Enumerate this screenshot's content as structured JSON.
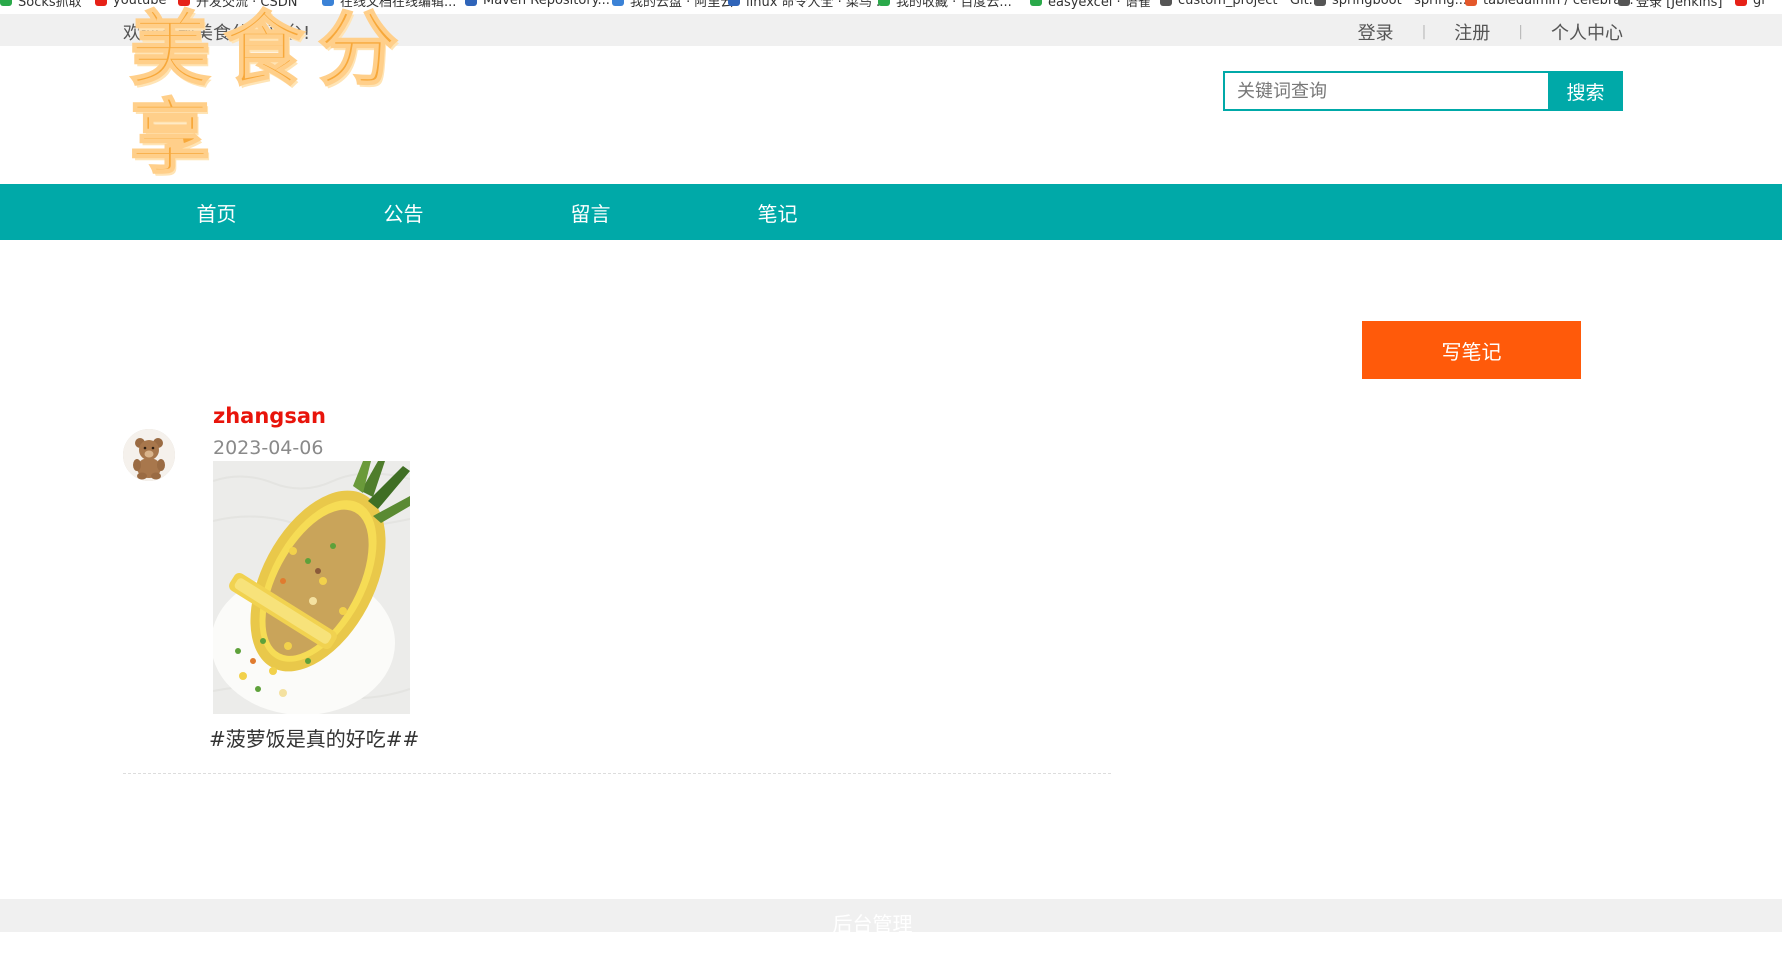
{
  "bookmarks": [
    {
      "label": "Socks抓取",
      "color": "#2aa94a"
    },
    {
      "label": "youtube",
      "color": "#e62117"
    },
    {
      "label": "开发交流 · CSDN",
      "color": "#e62117"
    },
    {
      "label": "在线文档在线编辑...",
      "color": "#3b82d6"
    },
    {
      "label": "Maven Repository...",
      "color": "#2f64b9"
    },
    {
      "label": "我的云盘 · 阿里云",
      "color": "#3b82d6"
    },
    {
      "label": "linux 命令大全 · 菜鸟 ...",
      "color": "#2f64b9"
    },
    {
      "label": "我的收藏 · 百度云...",
      "color": "#2aa94a"
    },
    {
      "label": "easyexcel · 语雀",
      "color": "#2aa94a"
    },
    {
      "label": "custom_project · Git...",
      "color": "#555555"
    },
    {
      "label": "springboot · spring...",
      "color": "#555555"
    },
    {
      "label": "tabledaimin / celebra...",
      "color": "#e4582b"
    },
    {
      "label": "登录 [Jenkins]",
      "color": "#555555"
    },
    {
      "label": "gi",
      "color": "#e62117"
    }
  ],
  "topbar": {
    "welcome": "欢迎来到美食分享平台!",
    "login": "登录",
    "register": "注册",
    "profile": "个人中心"
  },
  "header": {
    "logo_text": "美食分享",
    "search_placeholder": "关键词查询",
    "search_button": "搜索"
  },
  "nav": {
    "items": [
      "首页",
      "公告",
      "留言",
      "笔记"
    ]
  },
  "main": {
    "write_button": "写笔记",
    "post": {
      "username": "zhangsan",
      "date": "2023-04-06",
      "content": "#菠萝饭是真的好吃##"
    }
  },
  "footer": {
    "admin_link": "后台管理"
  },
  "colors": {
    "accent": "#00a9a8",
    "write_button": "#ff5a0a",
    "username": "#e8140b",
    "logo": "#f7a83a"
  }
}
